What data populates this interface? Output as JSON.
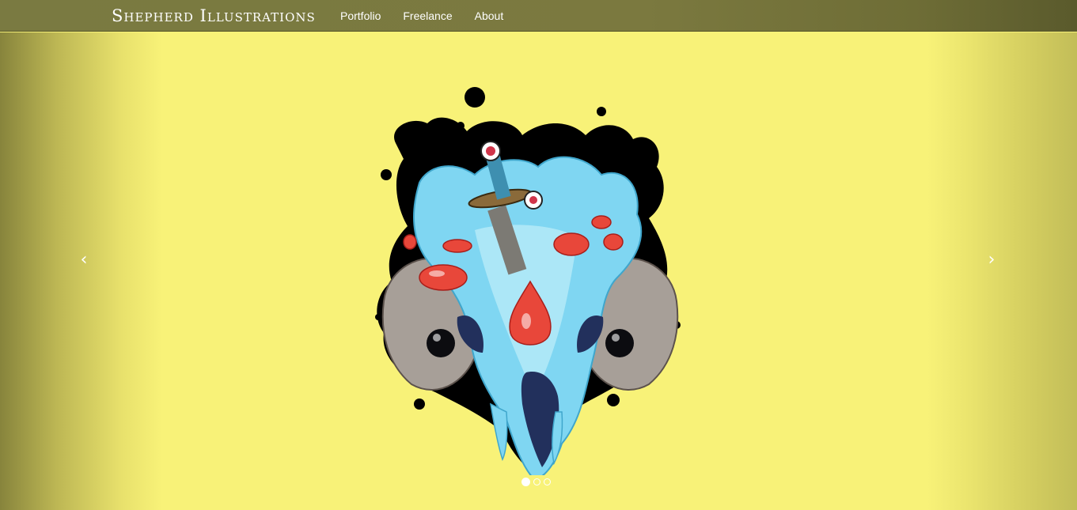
{
  "navbar": {
    "brand": "Shepherd Illustrations",
    "links": [
      {
        "label": "Portfolio"
      },
      {
        "label": "Freelance"
      },
      {
        "label": "About"
      }
    ]
  },
  "carousel": {
    "prev_icon": "chevron-left-icon",
    "next_icon": "chevron-right-icon",
    "prev_glyph": "‹",
    "next_glyph": "›",
    "slide_count": 3,
    "active_slide": 1,
    "background_color": "#f8f278"
  },
  "colors": {
    "navbar": "#7a7a41",
    "accent_yellow": "#f8f278",
    "ink": "#000000",
    "ice_blue": "#7fd6f2",
    "blood_red": "#e8473a"
  }
}
